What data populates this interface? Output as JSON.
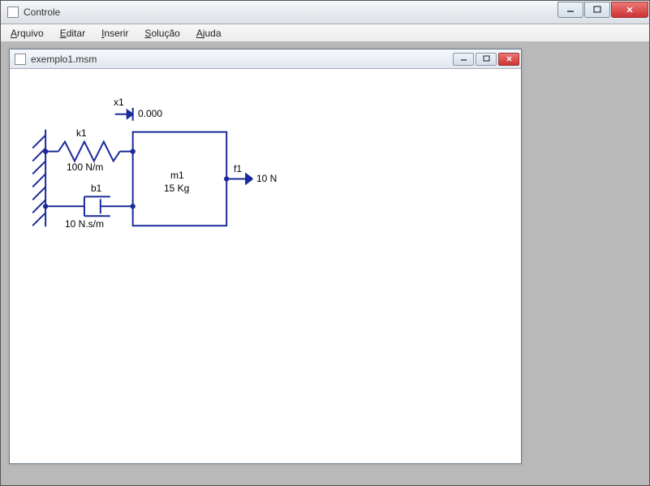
{
  "window": {
    "title": "Controle"
  },
  "menu": {
    "arquivo": "Arquivo",
    "editar": "Editar",
    "inserir": "Inserir",
    "solucao": "Solução",
    "ajuda": "Ajuda"
  },
  "child": {
    "title": "exemplo1.msm"
  },
  "diagram": {
    "position": {
      "label": "x1",
      "value": "0.000"
    },
    "spring": {
      "label": "k1",
      "value": "100 N/m"
    },
    "damper": {
      "label": "b1",
      "value": "10 N.s/m"
    },
    "mass": {
      "label": "m1",
      "value": "15 Kg"
    },
    "force": {
      "label": "f1",
      "value": "10 N"
    }
  }
}
